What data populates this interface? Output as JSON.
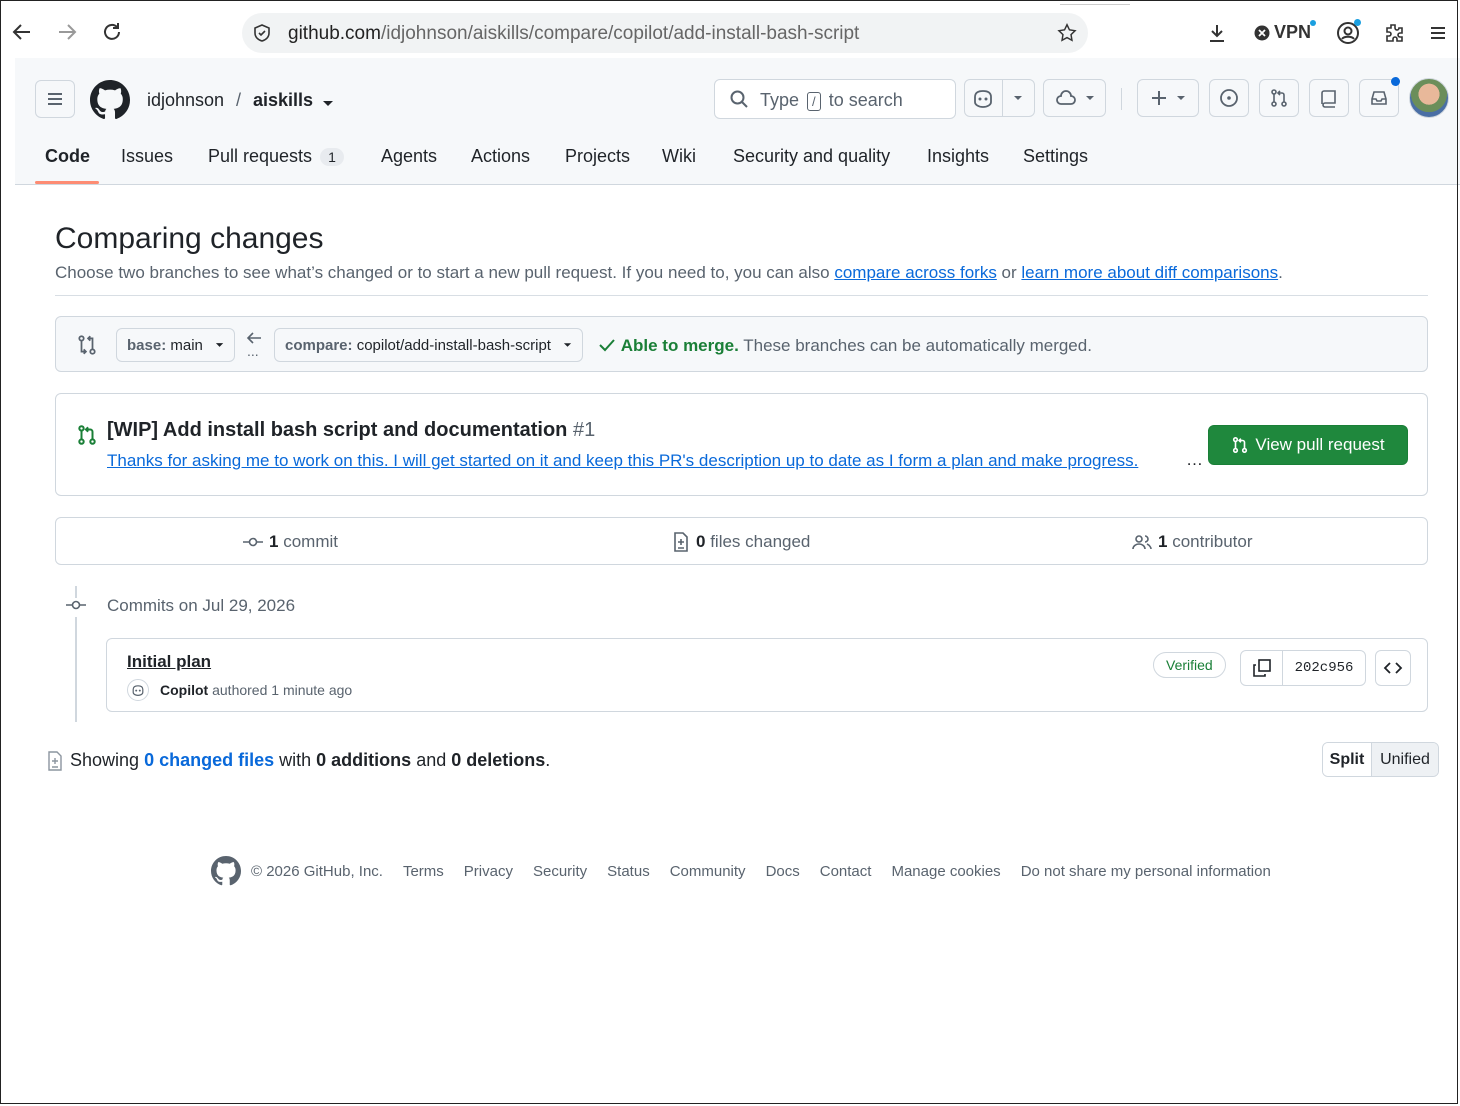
{
  "browser": {
    "url_host": "github.com",
    "url_path": "/idjohnson/aiskills/compare/copilot/add-install-bash-script",
    "vpn_label": "VPN"
  },
  "header": {
    "owner": "idjohnson",
    "separator": "/",
    "repo": "aiskills",
    "search_prefix": "Type",
    "search_key": "/",
    "search_suffix": "to search"
  },
  "tabs": [
    {
      "label": "Code"
    },
    {
      "label": "Issues"
    },
    {
      "label": "Pull requests",
      "count": "1"
    },
    {
      "label": "Agents"
    },
    {
      "label": "Actions"
    },
    {
      "label": "Projects"
    },
    {
      "label": "Wiki"
    },
    {
      "label": "Security and quality"
    },
    {
      "label": "Insights"
    },
    {
      "label": "Settings"
    }
  ],
  "main": {
    "title": "Comparing changes",
    "subtitle_pre": "Choose two branches to see what’s changed or to start a new pull request. If you need to, you can also ",
    "link_forks": "compare across forks",
    "subtitle_mid": " or ",
    "link_learn": "learn more about diff comparisons",
    "subtitle_end": "."
  },
  "range": {
    "base_label": "base:",
    "base_value": "main",
    "compare_label": "compare:",
    "compare_value": "copilot/add-install-bash-script",
    "dots": "...",
    "merge_status": "Able to merge.",
    "merge_detail": "These branches can be automatically merged."
  },
  "pr": {
    "title": "[WIP] Add install bash script and documentation",
    "number": "#1",
    "description": "Thanks for asking me to work on this. I will get started on it and keep this PR's description up to date as I form a plan and make progress.",
    "ellipsis": "…",
    "button": "View pull request"
  },
  "stats": {
    "commits_count": "1",
    "commits_label": "commit",
    "files_count": "0",
    "files_label": "files changed",
    "contributors_count": "1",
    "contributors_label": "contributor"
  },
  "commits": {
    "group_label": "Commits on Jul 29, 2026",
    "items": [
      {
        "title": "Initial plan",
        "author": "Copilot",
        "meta": "authored 1 minute ago",
        "badge": "Verified",
        "sha": "202c956"
      }
    ]
  },
  "toc": {
    "showing": "Showing",
    "changed_files": "0 changed files",
    "with": "with",
    "additions": "0 additions",
    "and": "and",
    "deletions": "0 deletions",
    "period": "."
  },
  "view_toggle": {
    "split": "Split",
    "unified": "Unified"
  },
  "footer": {
    "copyright": "© 2026 GitHub, Inc.",
    "links": [
      "Terms",
      "Privacy",
      "Security",
      "Status",
      "Community",
      "Docs",
      "Contact",
      "Manage cookies",
      "Do not share my personal information"
    ]
  },
  "colors": {
    "accent_green": "#1f883d",
    "link_blue": "#0969da",
    "tab_underline": "#fd8c73"
  }
}
